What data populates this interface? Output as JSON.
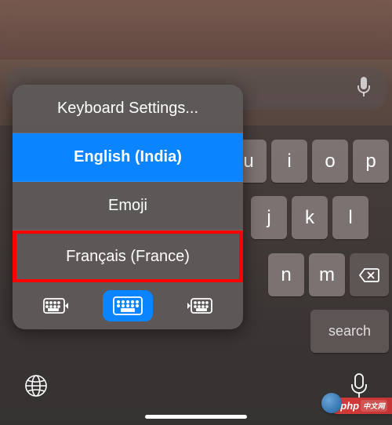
{
  "popup": {
    "settings_label": "Keyboard Settings...",
    "options": [
      {
        "label": "English (India)",
        "selected": true
      },
      {
        "label": "Emoji",
        "selected": false
      },
      {
        "label": "Français (France)",
        "selected": false,
        "highlighted": true
      }
    ]
  },
  "keyboard": {
    "row1": [
      "u",
      "i",
      "o",
      "p"
    ],
    "row2": [
      "j",
      "k",
      "l"
    ],
    "row3": [
      "n",
      "m"
    ],
    "search_label": "search"
  },
  "bottom": {
    "globe_icon": "globe-icon",
    "mic_icon": "mic-icon"
  },
  "watermark": {
    "main": "php",
    "sub": "中文网"
  }
}
